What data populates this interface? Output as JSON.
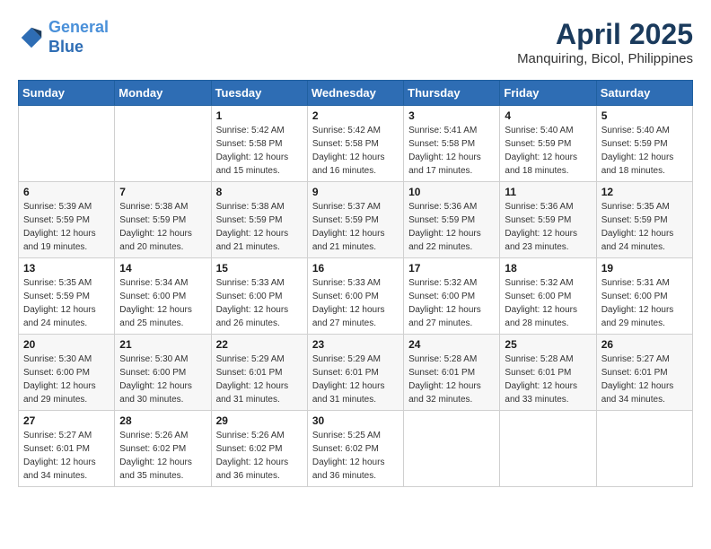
{
  "header": {
    "logo_line1": "General",
    "logo_line2": "Blue",
    "title": "April 2025",
    "subtitle": "Manquiring, Bicol, Philippines"
  },
  "weekdays": [
    "Sunday",
    "Monday",
    "Tuesday",
    "Wednesday",
    "Thursday",
    "Friday",
    "Saturday"
  ],
  "weeks": [
    [
      {
        "day": "",
        "sunrise": "",
        "sunset": "",
        "daylight": ""
      },
      {
        "day": "",
        "sunrise": "",
        "sunset": "",
        "daylight": ""
      },
      {
        "day": "1",
        "sunrise": "Sunrise: 5:42 AM",
        "sunset": "Sunset: 5:58 PM",
        "daylight": "Daylight: 12 hours and 15 minutes."
      },
      {
        "day": "2",
        "sunrise": "Sunrise: 5:42 AM",
        "sunset": "Sunset: 5:58 PM",
        "daylight": "Daylight: 12 hours and 16 minutes."
      },
      {
        "day": "3",
        "sunrise": "Sunrise: 5:41 AM",
        "sunset": "Sunset: 5:58 PM",
        "daylight": "Daylight: 12 hours and 17 minutes."
      },
      {
        "day": "4",
        "sunrise": "Sunrise: 5:40 AM",
        "sunset": "Sunset: 5:59 PM",
        "daylight": "Daylight: 12 hours and 18 minutes."
      },
      {
        "day": "5",
        "sunrise": "Sunrise: 5:40 AM",
        "sunset": "Sunset: 5:59 PM",
        "daylight": "Daylight: 12 hours and 18 minutes."
      }
    ],
    [
      {
        "day": "6",
        "sunrise": "Sunrise: 5:39 AM",
        "sunset": "Sunset: 5:59 PM",
        "daylight": "Daylight: 12 hours and 19 minutes."
      },
      {
        "day": "7",
        "sunrise": "Sunrise: 5:38 AM",
        "sunset": "Sunset: 5:59 PM",
        "daylight": "Daylight: 12 hours and 20 minutes."
      },
      {
        "day": "8",
        "sunrise": "Sunrise: 5:38 AM",
        "sunset": "Sunset: 5:59 PM",
        "daylight": "Daylight: 12 hours and 21 minutes."
      },
      {
        "day": "9",
        "sunrise": "Sunrise: 5:37 AM",
        "sunset": "Sunset: 5:59 PM",
        "daylight": "Daylight: 12 hours and 21 minutes."
      },
      {
        "day": "10",
        "sunrise": "Sunrise: 5:36 AM",
        "sunset": "Sunset: 5:59 PM",
        "daylight": "Daylight: 12 hours and 22 minutes."
      },
      {
        "day": "11",
        "sunrise": "Sunrise: 5:36 AM",
        "sunset": "Sunset: 5:59 PM",
        "daylight": "Daylight: 12 hours and 23 minutes."
      },
      {
        "day": "12",
        "sunrise": "Sunrise: 5:35 AM",
        "sunset": "Sunset: 5:59 PM",
        "daylight": "Daylight: 12 hours and 24 minutes."
      }
    ],
    [
      {
        "day": "13",
        "sunrise": "Sunrise: 5:35 AM",
        "sunset": "Sunset: 5:59 PM",
        "daylight": "Daylight: 12 hours and 24 minutes."
      },
      {
        "day": "14",
        "sunrise": "Sunrise: 5:34 AM",
        "sunset": "Sunset: 6:00 PM",
        "daylight": "Daylight: 12 hours and 25 minutes."
      },
      {
        "day": "15",
        "sunrise": "Sunrise: 5:33 AM",
        "sunset": "Sunset: 6:00 PM",
        "daylight": "Daylight: 12 hours and 26 minutes."
      },
      {
        "day": "16",
        "sunrise": "Sunrise: 5:33 AM",
        "sunset": "Sunset: 6:00 PM",
        "daylight": "Daylight: 12 hours and 27 minutes."
      },
      {
        "day": "17",
        "sunrise": "Sunrise: 5:32 AM",
        "sunset": "Sunset: 6:00 PM",
        "daylight": "Daylight: 12 hours and 27 minutes."
      },
      {
        "day": "18",
        "sunrise": "Sunrise: 5:32 AM",
        "sunset": "Sunset: 6:00 PM",
        "daylight": "Daylight: 12 hours and 28 minutes."
      },
      {
        "day": "19",
        "sunrise": "Sunrise: 5:31 AM",
        "sunset": "Sunset: 6:00 PM",
        "daylight": "Daylight: 12 hours and 29 minutes."
      }
    ],
    [
      {
        "day": "20",
        "sunrise": "Sunrise: 5:30 AM",
        "sunset": "Sunset: 6:00 PM",
        "daylight": "Daylight: 12 hours and 29 minutes."
      },
      {
        "day": "21",
        "sunrise": "Sunrise: 5:30 AM",
        "sunset": "Sunset: 6:00 PM",
        "daylight": "Daylight: 12 hours and 30 minutes."
      },
      {
        "day": "22",
        "sunrise": "Sunrise: 5:29 AM",
        "sunset": "Sunset: 6:01 PM",
        "daylight": "Daylight: 12 hours and 31 minutes."
      },
      {
        "day": "23",
        "sunrise": "Sunrise: 5:29 AM",
        "sunset": "Sunset: 6:01 PM",
        "daylight": "Daylight: 12 hours and 31 minutes."
      },
      {
        "day": "24",
        "sunrise": "Sunrise: 5:28 AM",
        "sunset": "Sunset: 6:01 PM",
        "daylight": "Daylight: 12 hours and 32 minutes."
      },
      {
        "day": "25",
        "sunrise": "Sunrise: 5:28 AM",
        "sunset": "Sunset: 6:01 PM",
        "daylight": "Daylight: 12 hours and 33 minutes."
      },
      {
        "day": "26",
        "sunrise": "Sunrise: 5:27 AM",
        "sunset": "Sunset: 6:01 PM",
        "daylight": "Daylight: 12 hours and 34 minutes."
      }
    ],
    [
      {
        "day": "27",
        "sunrise": "Sunrise: 5:27 AM",
        "sunset": "Sunset: 6:01 PM",
        "daylight": "Daylight: 12 hours and 34 minutes."
      },
      {
        "day": "28",
        "sunrise": "Sunrise: 5:26 AM",
        "sunset": "Sunset: 6:02 PM",
        "daylight": "Daylight: 12 hours and 35 minutes."
      },
      {
        "day": "29",
        "sunrise": "Sunrise: 5:26 AM",
        "sunset": "Sunset: 6:02 PM",
        "daylight": "Daylight: 12 hours and 36 minutes."
      },
      {
        "day": "30",
        "sunrise": "Sunrise: 5:25 AM",
        "sunset": "Sunset: 6:02 PM",
        "daylight": "Daylight: 12 hours and 36 minutes."
      },
      {
        "day": "",
        "sunrise": "",
        "sunset": "",
        "daylight": ""
      },
      {
        "day": "",
        "sunrise": "",
        "sunset": "",
        "daylight": ""
      },
      {
        "day": "",
        "sunrise": "",
        "sunset": "",
        "daylight": ""
      }
    ]
  ]
}
